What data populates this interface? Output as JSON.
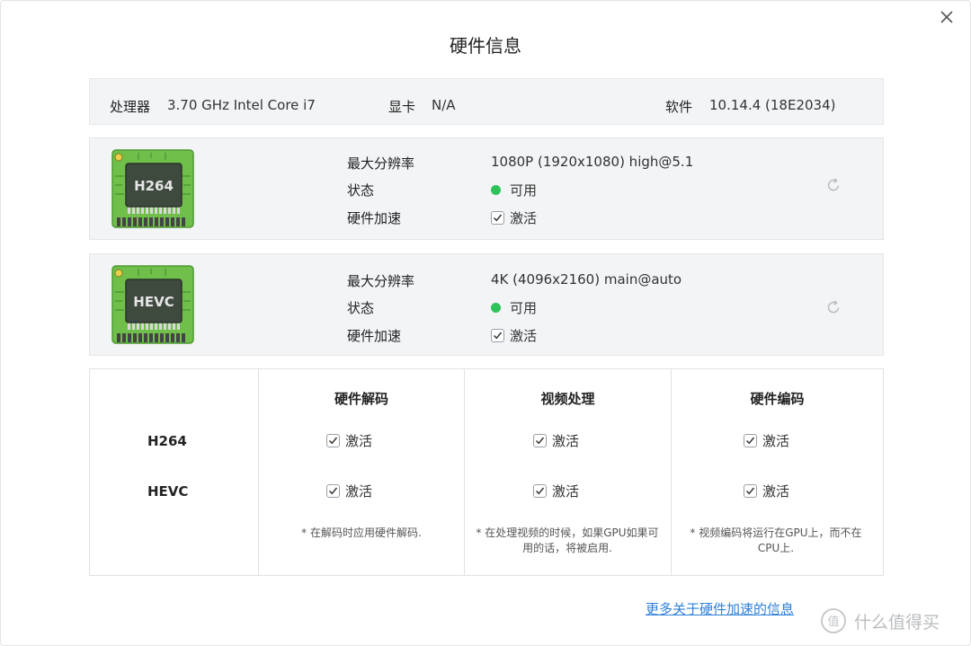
{
  "dialog": {
    "title": "硬件信息",
    "more_link": "更多关于硬件加速的信息"
  },
  "system": {
    "cpu_label": "处理器",
    "cpu_value": "3.70 GHz Intel Core i7",
    "gpu_label": "显卡",
    "gpu_value": "N/A",
    "software_label": "软件",
    "software_value": "10.14.4 (18E2034)"
  },
  "codecs": [
    {
      "chip_label": "H264",
      "max_res_label": "最大分辨率",
      "max_res_value": "1080P (1920x1080) high@5.1",
      "status_label": "状态",
      "status_value": "可用",
      "hw_accel_label": "硬件加速",
      "hw_accel_value": "激活",
      "hw_accel_checked": true
    },
    {
      "chip_label": "HEVC",
      "max_res_label": "最大分辨率",
      "max_res_value": "4K (4096x2160) main@auto",
      "status_label": "状态",
      "status_value": "可用",
      "hw_accel_label": "硬件加速",
      "hw_accel_value": "激活",
      "hw_accel_checked": true
    }
  ],
  "matrix": {
    "columns": [
      "硬件解码",
      "视频处理",
      "硬件编码"
    ],
    "rows": [
      {
        "name": "H264",
        "cells": [
          "激活",
          "激活",
          "激活"
        ]
      },
      {
        "name": "HEVC",
        "cells": [
          "激活",
          "激活",
          "激活"
        ]
      }
    ],
    "notes": [
      "* 在解码时应用硬件解码.",
      "* 在处理视频的时候，如果GPU如果可用的话，将被启用.",
      "* 视频编码将运行在GPU上，而不在CPU上."
    ]
  },
  "watermark": {
    "text": "什么值得买",
    "logo_char": "值"
  },
  "colors": {
    "status_ok": "#2ec25b",
    "link": "#2f7fd8",
    "chip_board": "#6fbf4a"
  },
  "icons": {
    "close": "close-icon",
    "refresh": "refresh-icon",
    "checkbox": "checkmark-icon",
    "chip": "chip-icon"
  }
}
